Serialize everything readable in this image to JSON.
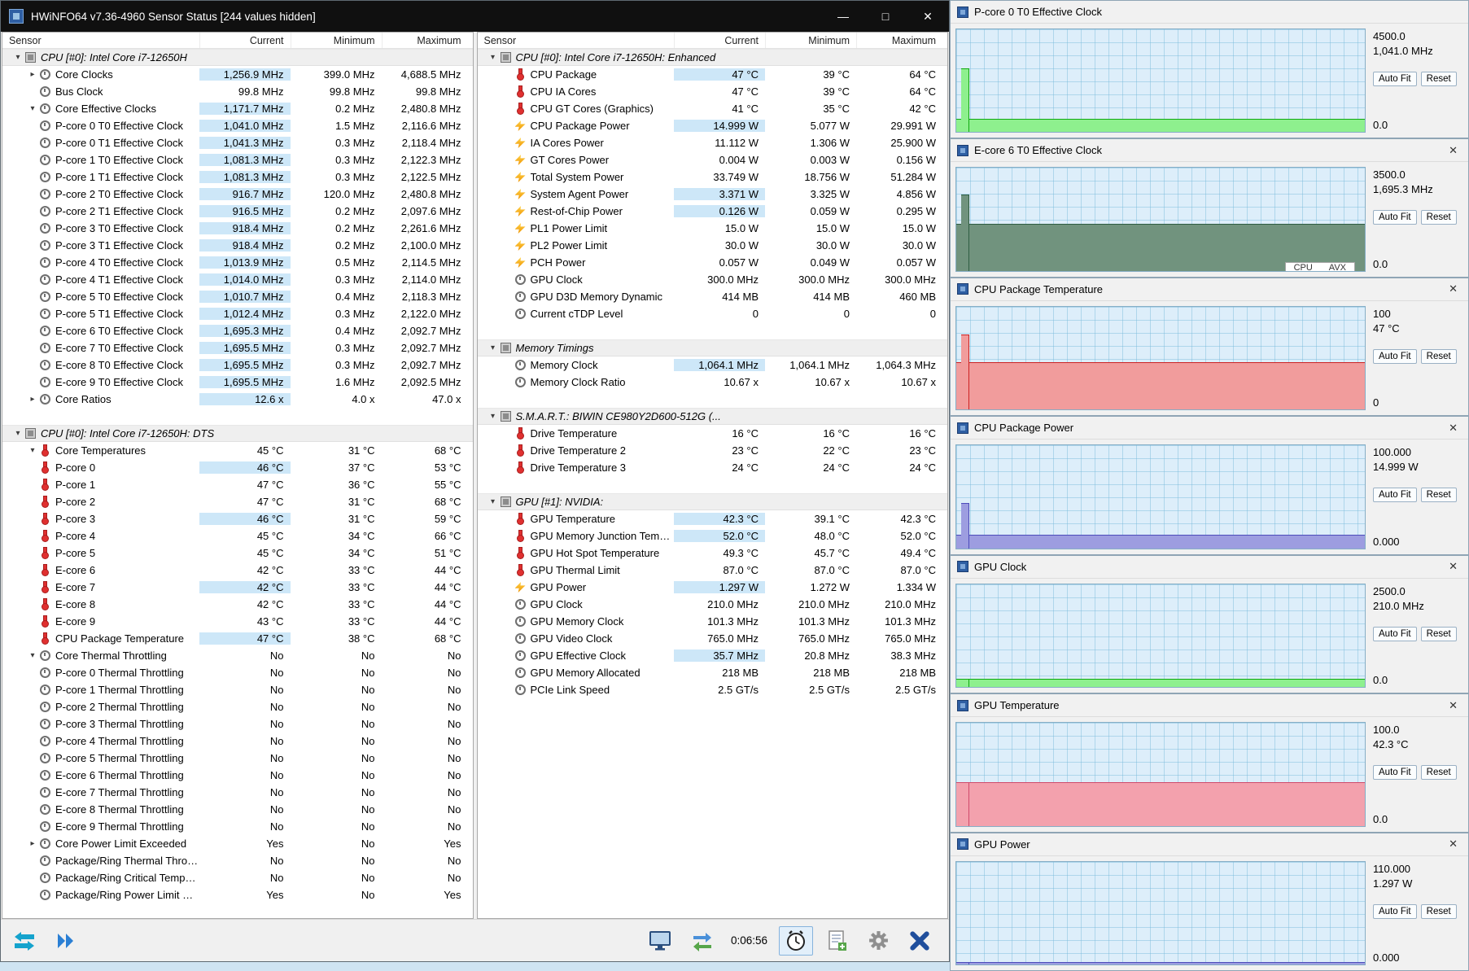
{
  "window": {
    "title": "HWiNFO64 v7.36-4960 Sensor Status [244 values hidden]",
    "controls": {
      "minimize": "—",
      "maximize": "□",
      "close": "✕"
    }
  },
  "columns": {
    "sensor": "Sensor",
    "current": "Current",
    "minimum": "Minimum",
    "maximum": "Maximum"
  },
  "theme": {
    "highlight": "#cde7f8",
    "titlebar_bg": "#101010",
    "section_bg": "#efefef"
  },
  "left_rows": [
    {
      "t": "s",
      "a": "d",
      "i": "chip",
      "n": "CPU [#0]: Intel Core i7-12650H"
    },
    {
      "t": "r",
      "a": "r",
      "i": "clk",
      "n": "Core Clocks",
      "c": "1,256.9 MHz",
      "m": "399.0 MHz",
      "x": "4,688.5 MHz",
      "hl": true
    },
    {
      "t": "r",
      "a": "n",
      "i": "clk",
      "n": "Bus Clock",
      "c": "99.8 MHz",
      "m": "99.8 MHz",
      "x": "99.8 MHz",
      "hl": false
    },
    {
      "t": "r",
      "a": "d",
      "i": "clk",
      "n": "Core Effective Clocks",
      "c": "1,171.7 MHz",
      "m": "0.2 MHz",
      "x": "2,480.8 MHz",
      "hl": true
    },
    {
      "t": "r",
      "a": "n",
      "i": "clk",
      "n": "P-core 0 T0 Effective Clock",
      "c": "1,041.0 MHz",
      "m": "1.5 MHz",
      "x": "2,116.6 MHz",
      "hl": true
    },
    {
      "t": "r",
      "a": "n",
      "i": "clk",
      "n": "P-core 0 T1 Effective Clock",
      "c": "1,041.3 MHz",
      "m": "0.3 MHz",
      "x": "2,118.4 MHz",
      "hl": true
    },
    {
      "t": "r",
      "a": "n",
      "i": "clk",
      "n": "P-core 1 T0 Effective Clock",
      "c": "1,081.3 MHz",
      "m": "0.3 MHz",
      "x": "2,122.3 MHz",
      "hl": true
    },
    {
      "t": "r",
      "a": "n",
      "i": "clk",
      "n": "P-core 1 T1 Effective Clock",
      "c": "1,081.3 MHz",
      "m": "0.3 MHz",
      "x": "2,122.5 MHz",
      "hl": true
    },
    {
      "t": "r",
      "a": "n",
      "i": "clk",
      "n": "P-core 2 T0 Effective Clock",
      "c": "916.7 MHz",
      "m": "120.0 MHz",
      "x": "2,480.8 MHz",
      "hl": true
    },
    {
      "t": "r",
      "a": "n",
      "i": "clk",
      "n": "P-core 2 T1 Effective Clock",
      "c": "916.5 MHz",
      "m": "0.2 MHz",
      "x": "2,097.6 MHz",
      "hl": true
    },
    {
      "t": "r",
      "a": "n",
      "i": "clk",
      "n": "P-core 3 T0 Effective Clock",
      "c": "918.4 MHz",
      "m": "0.2 MHz",
      "x": "2,261.6 MHz",
      "hl": true
    },
    {
      "t": "r",
      "a": "n",
      "i": "clk",
      "n": "P-core 3 T1 Effective Clock",
      "c": "918.4 MHz",
      "m": "0.2 MHz",
      "x": "2,100.0 MHz",
      "hl": true
    },
    {
      "t": "r",
      "a": "n",
      "i": "clk",
      "n": "P-core 4 T0 Effective Clock",
      "c": "1,013.9 MHz",
      "m": "0.5 MHz",
      "x": "2,114.5 MHz",
      "hl": true
    },
    {
      "t": "r",
      "a": "n",
      "i": "clk",
      "n": "P-core 4 T1 Effective Clock",
      "c": "1,014.0 MHz",
      "m": "0.3 MHz",
      "x": "2,114.0 MHz",
      "hl": true
    },
    {
      "t": "r",
      "a": "n",
      "i": "clk",
      "n": "P-core 5 T0 Effective Clock",
      "c": "1,010.7 MHz",
      "m": "0.4 MHz",
      "x": "2,118.3 MHz",
      "hl": true
    },
    {
      "t": "r",
      "a": "n",
      "i": "clk",
      "n": "P-core 5 T1 Effective Clock",
      "c": "1,012.4 MHz",
      "m": "0.3 MHz",
      "x": "2,122.0 MHz",
      "hl": true
    },
    {
      "t": "r",
      "a": "n",
      "i": "clk",
      "n": "E-core 6 T0 Effective Clock",
      "c": "1,695.3 MHz",
      "m": "0.4 MHz",
      "x": "2,092.7 MHz",
      "hl": true
    },
    {
      "t": "r",
      "a": "n",
      "i": "clk",
      "n": "E-core 7 T0 Effective Clock",
      "c": "1,695.5 MHz",
      "m": "0.3 MHz",
      "x": "2,092.7 MHz",
      "hl": true
    },
    {
      "t": "r",
      "a": "n",
      "i": "clk",
      "n": "E-core 8 T0 Effective Clock",
      "c": "1,695.5 MHz",
      "m": "0.3 MHz",
      "x": "2,092.7 MHz",
      "hl": true
    },
    {
      "t": "r",
      "a": "n",
      "i": "clk",
      "n": "E-core 9 T0 Effective Clock",
      "c": "1,695.5 MHz",
      "m": "1.6 MHz",
      "x": "2,092.5 MHz",
      "hl": true
    },
    {
      "t": "r",
      "a": "r",
      "i": "clk",
      "n": "Core Ratios",
      "c": "12.6 x",
      "m": "4.0 x",
      "x": "47.0 x",
      "hl": true
    },
    {
      "t": "g"
    },
    {
      "t": "s",
      "a": "d",
      "i": "chip",
      "n": "CPU [#0]: Intel Core i7-12650H: DTS"
    },
    {
      "t": "r",
      "a": "d",
      "i": "tmp",
      "n": "Core Temperatures",
      "c": "45 °C",
      "m": "31 °C",
      "x": "68 °C",
      "hl": false
    },
    {
      "t": "r",
      "a": "n",
      "i": "tmp",
      "n": "P-core 0",
      "c": "46 °C",
      "m": "37 °C",
      "x": "53 °C",
      "hl": true
    },
    {
      "t": "r",
      "a": "n",
      "i": "tmp",
      "n": "P-core 1",
      "c": "47 °C",
      "m": "36 °C",
      "x": "55 °C",
      "hl": false
    },
    {
      "t": "r",
      "a": "n",
      "i": "tmp",
      "n": "P-core 2",
      "c": "47 °C",
      "m": "31 °C",
      "x": "68 °C",
      "hl": false
    },
    {
      "t": "r",
      "a": "n",
      "i": "tmp",
      "n": "P-core 3",
      "c": "46 °C",
      "m": "31 °C",
      "x": "59 °C",
      "hl": true
    },
    {
      "t": "r",
      "a": "n",
      "i": "tmp",
      "n": "P-core 4",
      "c": "45 °C",
      "m": "34 °C",
      "x": "66 °C",
      "hl": false
    },
    {
      "t": "r",
      "a": "n",
      "i": "tmp",
      "n": "P-core 5",
      "c": "45 °C",
      "m": "34 °C",
      "x": "51 °C",
      "hl": false
    },
    {
      "t": "r",
      "a": "n",
      "i": "tmp",
      "n": "E-core 6",
      "c": "42 °C",
      "m": "33 °C",
      "x": "44 °C",
      "hl": false
    },
    {
      "t": "r",
      "a": "n",
      "i": "tmp",
      "n": "E-core 7",
      "c": "42 °C",
      "m": "33 °C",
      "x": "44 °C",
      "hl": true
    },
    {
      "t": "r",
      "a": "n",
      "i": "tmp",
      "n": "E-core 8",
      "c": "42 °C",
      "m": "33 °C",
      "x": "44 °C",
      "hl": false
    },
    {
      "t": "r",
      "a": "n",
      "i": "tmp",
      "n": "E-core 9",
      "c": "43 °C",
      "m": "33 °C",
      "x": "44 °C",
      "hl": false
    },
    {
      "t": "r",
      "a": "n",
      "i": "tmp",
      "n": "CPU Package Temperature",
      "c": "47 °C",
      "m": "38 °C",
      "x": "68 °C",
      "hl": true
    },
    {
      "t": "r",
      "a": "d",
      "i": "clk",
      "n": "Core Thermal Throttling",
      "c": "No",
      "m": "No",
      "x": "No",
      "hl": false
    },
    {
      "t": "r",
      "a": "n",
      "i": "clk",
      "n": "P-core 0 Thermal Throttling",
      "c": "No",
      "m": "No",
      "x": "No",
      "hl": false
    },
    {
      "t": "r",
      "a": "n",
      "i": "clk",
      "n": "P-core 1 Thermal Throttling",
      "c": "No",
      "m": "No",
      "x": "No",
      "hl": false
    },
    {
      "t": "r",
      "a": "n",
      "i": "clk",
      "n": "P-core 2 Thermal Throttling",
      "c": "No",
      "m": "No",
      "x": "No",
      "hl": false
    },
    {
      "t": "r",
      "a": "n",
      "i": "clk",
      "n": "P-core 3 Thermal Throttling",
      "c": "No",
      "m": "No",
      "x": "No",
      "hl": false
    },
    {
      "t": "r",
      "a": "n",
      "i": "clk",
      "n": "P-core 4 Thermal Throttling",
      "c": "No",
      "m": "No",
      "x": "No",
      "hl": false
    },
    {
      "t": "r",
      "a": "n",
      "i": "clk",
      "n": "P-core 5 Thermal Throttling",
      "c": "No",
      "m": "No",
      "x": "No",
      "hl": false
    },
    {
      "t": "r",
      "a": "n",
      "i": "clk",
      "n": "E-core 6 Thermal Throttling",
      "c": "No",
      "m": "No",
      "x": "No",
      "hl": false
    },
    {
      "t": "r",
      "a": "n",
      "i": "clk",
      "n": "E-core 7 Thermal Throttling",
      "c": "No",
      "m": "No",
      "x": "No",
      "hl": false
    },
    {
      "t": "r",
      "a": "n",
      "i": "clk",
      "n": "E-core 8 Thermal Throttling",
      "c": "No",
      "m": "No",
      "x": "No",
      "hl": false
    },
    {
      "t": "r",
      "a": "n",
      "i": "clk",
      "n": "E-core 9 Thermal Throttling",
      "c": "No",
      "m": "No",
      "x": "No",
      "hl": false
    },
    {
      "t": "r",
      "a": "r",
      "i": "clk",
      "n": "Core Power Limit Exceeded",
      "c": "Yes",
      "m": "No",
      "x": "Yes",
      "hl": false
    },
    {
      "t": "r",
      "a": "n",
      "i": "clk",
      "n": "Package/Ring Thermal Throttling",
      "c": "No",
      "m": "No",
      "x": "No",
      "hl": false
    },
    {
      "t": "r",
      "a": "n",
      "i": "clk",
      "n": "Package/Ring Critical Temperature",
      "c": "No",
      "m": "No",
      "x": "No",
      "hl": false
    },
    {
      "t": "r",
      "a": "n",
      "i": "clk",
      "n": "Package/Ring Power Limit Exceeded",
      "c": "Yes",
      "m": "No",
      "x": "Yes",
      "hl": false
    }
  ],
  "right_rows": [
    {
      "t": "s",
      "a": "d",
      "i": "chip",
      "n": "CPU [#0]: Intel Core i7-12650H: Enhanced"
    },
    {
      "t": "r",
      "a": "n",
      "i": "tmp",
      "n": "CPU Package",
      "c": "47 °C",
      "m": "39 °C",
      "x": "64 °C",
      "hl": true
    },
    {
      "t": "r",
      "a": "n",
      "i": "tmp",
      "n": "CPU IA Cores",
      "c": "47 °C",
      "m": "39 °C",
      "x": "64 °C",
      "hl": false
    },
    {
      "t": "r",
      "a": "n",
      "i": "tmp",
      "n": "CPU GT Cores (Graphics)",
      "c": "41 °C",
      "m": "35 °C",
      "x": "42 °C",
      "hl": false
    },
    {
      "t": "r",
      "a": "n",
      "i": "pwr",
      "n": "CPU Package Power",
      "c": "14.999 W",
      "m": "5.077 W",
      "x": "29.991 W",
      "hl": true
    },
    {
      "t": "r",
      "a": "n",
      "i": "pwr",
      "n": "IA Cores Power",
      "c": "11.112 W",
      "m": "1.306 W",
      "x": "25.900 W",
      "hl": false
    },
    {
      "t": "r",
      "a": "n",
      "i": "pwr",
      "n": "GT Cores Power",
      "c": "0.004 W",
      "m": "0.003 W",
      "x": "0.156 W",
      "hl": false
    },
    {
      "t": "r",
      "a": "n",
      "i": "pwr",
      "n": "Total System Power",
      "c": "33.749 W",
      "m": "18.756 W",
      "x": "51.284 W",
      "hl": false
    },
    {
      "t": "r",
      "a": "n",
      "i": "pwr",
      "n": "System Agent Power",
      "c": "3.371 W",
      "m": "3.325 W",
      "x": "4.856 W",
      "hl": true
    },
    {
      "t": "r",
      "a": "n",
      "i": "pwr",
      "n": "Rest-of-Chip Power",
      "c": "0.126 W",
      "m": "0.059 W",
      "x": "0.295 W",
      "hl": true
    },
    {
      "t": "r",
      "a": "n",
      "i": "pwr",
      "n": "PL1 Power Limit",
      "c": "15.0 W",
      "m": "15.0 W",
      "x": "15.0 W",
      "hl": false
    },
    {
      "t": "r",
      "a": "n",
      "i": "pwr",
      "n": "PL2 Power Limit",
      "c": "30.0 W",
      "m": "30.0 W",
      "x": "30.0 W",
      "hl": false
    },
    {
      "t": "r",
      "a": "n",
      "i": "pwr",
      "n": "PCH Power",
      "c": "0.057 W",
      "m": "0.049 W",
      "x": "0.057 W",
      "hl": false
    },
    {
      "t": "r",
      "a": "n",
      "i": "clk",
      "n": "GPU Clock",
      "c": "300.0 MHz",
      "m": "300.0 MHz",
      "x": "300.0 MHz",
      "hl": false
    },
    {
      "t": "r",
      "a": "n",
      "i": "clk",
      "n": "GPU D3D Memory Dynamic",
      "c": "414 MB",
      "m": "414 MB",
      "x": "460 MB",
      "hl": false
    },
    {
      "t": "r",
      "a": "n",
      "i": "clk",
      "n": "Current cTDP Level",
      "c": "0",
      "m": "0",
      "x": "0",
      "hl": false
    },
    {
      "t": "g"
    },
    {
      "t": "s",
      "a": "d",
      "i": "chip",
      "n": "Memory Timings"
    },
    {
      "t": "r",
      "a": "n",
      "i": "clk",
      "n": "Memory Clock",
      "c": "1,064.1 MHz",
      "m": "1,064.1 MHz",
      "x": "1,064.3 MHz",
      "hl": true
    },
    {
      "t": "r",
      "a": "n",
      "i": "clk",
      "n": "Memory Clock Ratio",
      "c": "10.67 x",
      "m": "10.67 x",
      "x": "10.67 x",
      "hl": false
    },
    {
      "t": "g"
    },
    {
      "t": "s",
      "a": "d",
      "i": "chip",
      "n": "S.M.A.R.T.: BIWIN CE980Y2D600-512G (..."
    },
    {
      "t": "r",
      "a": "n",
      "i": "tmp",
      "n": "Drive Temperature",
      "c": "16 °C",
      "m": "16 °C",
      "x": "16 °C",
      "hl": false
    },
    {
      "t": "r",
      "a": "n",
      "i": "tmp",
      "n": "Drive Temperature 2",
      "c": "23 °C",
      "m": "22 °C",
      "x": "23 °C",
      "hl": false
    },
    {
      "t": "r",
      "a": "n",
      "i": "tmp",
      "n": "Drive Temperature 3",
      "c": "24 °C",
      "m": "24 °C",
      "x": "24 °C",
      "hl": false
    },
    {
      "t": "g"
    },
    {
      "t": "s",
      "a": "d",
      "i": "chip",
      "n": "GPU [#1]: NVIDIA:"
    },
    {
      "t": "r",
      "a": "n",
      "i": "tmp",
      "n": "GPU Temperature",
      "c": "42.3 °C",
      "m": "39.1 °C",
      "x": "42.3 °C",
      "hl": true
    },
    {
      "t": "r",
      "a": "n",
      "i": "tmp",
      "n": "GPU Memory Junction Temperature",
      "c": "52.0 °C",
      "m": "48.0 °C",
      "x": "52.0 °C",
      "hl": true
    },
    {
      "t": "r",
      "a": "n",
      "i": "tmp",
      "n": "GPU Hot Spot Temperature",
      "c": "49.3 °C",
      "m": "45.7 °C",
      "x": "49.4 °C",
      "hl": false
    },
    {
      "t": "r",
      "a": "n",
      "i": "tmp",
      "n": "GPU Thermal Limit",
      "c": "87.0 °C",
      "m": "87.0 °C",
      "x": "87.0 °C",
      "hl": false
    },
    {
      "t": "r",
      "a": "n",
      "i": "pwr",
      "n": "GPU Power",
      "c": "1.297 W",
      "m": "1.272 W",
      "x": "1.334 W",
      "hl": true
    },
    {
      "t": "r",
      "a": "n",
      "i": "clk",
      "n": "GPU Clock",
      "c": "210.0 MHz",
      "m": "210.0 MHz",
      "x": "210.0 MHz",
      "hl": false
    },
    {
      "t": "r",
      "a": "n",
      "i": "clk",
      "n": "GPU Memory Clock",
      "c": "101.3 MHz",
      "m": "101.3 MHz",
      "x": "101.3 MHz",
      "hl": false
    },
    {
      "t": "r",
      "a": "n",
      "i": "clk",
      "n": "GPU Video Clock",
      "c": "765.0 MHz",
      "m": "765.0 MHz",
      "x": "765.0 MHz",
      "hl": false
    },
    {
      "t": "r",
      "a": "n",
      "i": "clk",
      "n": "GPU Effective Clock",
      "c": "35.7 MHz",
      "m": "20.8 MHz",
      "x": "38.3 MHz",
      "hl": true
    },
    {
      "t": "r",
      "a": "n",
      "i": "clk",
      "n": "GPU Memory Allocated",
      "c": "218 MB",
      "m": "218 MB",
      "x": "218 MB",
      "hl": false
    },
    {
      "t": "r",
      "a": "n",
      "i": "clk",
      "n": "PCIe Link Speed",
      "c": "2.5 GT/s",
      "m": "2.5 GT/s",
      "x": "2.5 GT/s",
      "hl": false
    }
  ],
  "toolbar": {
    "elapsed": "0:06:56"
  },
  "graph_ui": {
    "auto_fit": "Auto Fit",
    "reset": "Reset"
  },
  "graphs": [
    {
      "title": "P-core 0 T0 Effective Clock",
      "max": "4500.0",
      "val": "1,041.0 MHz",
      "min": "0.0",
      "fill": "#8ef08e",
      "line": "#12a912",
      "base": 13,
      "spike": 62,
      "close": false
    },
    {
      "title": "E-core 6 T0 Effective Clock",
      "max": "3500.0",
      "val": "1,695.3 MHz",
      "min": "0.0",
      "fill": "#71937e",
      "line": "#2e5c42",
      "base": 46,
      "spike": 74,
      "close": true,
      "overlay": [
        "CPU",
        "AVX"
      ]
    },
    {
      "title": "CPU Package Temperature",
      "max": "100",
      "val": "47 °C",
      "min": "0",
      "fill": "#f19c9c",
      "line": "#cc2222",
      "base": 46,
      "spike": 73,
      "close": true
    },
    {
      "title": "CPU Package Power",
      "max": "100.000",
      "val": "14.999 W",
      "min": "0.000",
      "fill": "#9d9de0",
      "line": "#4c4cbb",
      "base": 13,
      "spike": 44,
      "close": true
    },
    {
      "title": "GPU Clock",
      "max": "2500.0",
      "val": "210.0 MHz",
      "min": "0.0",
      "fill": "#8ef08e",
      "line": "#12a912",
      "base": 8,
      "spike": 8,
      "close": true
    },
    {
      "title": "GPU Temperature",
      "max": "100.0",
      "val": "42.3 °C",
      "min": "0.0",
      "fill": "#f3a1ad",
      "line": "#d04a6a",
      "base": 42,
      "spike": 42,
      "close": true
    },
    {
      "title": "GPU Power",
      "max": "110.000",
      "val": "1.297 W",
      "min": "0.000",
      "fill": "#9d9de0",
      "line": "#4c4cbb",
      "base": 2,
      "spike": 2,
      "close": true
    }
  ]
}
